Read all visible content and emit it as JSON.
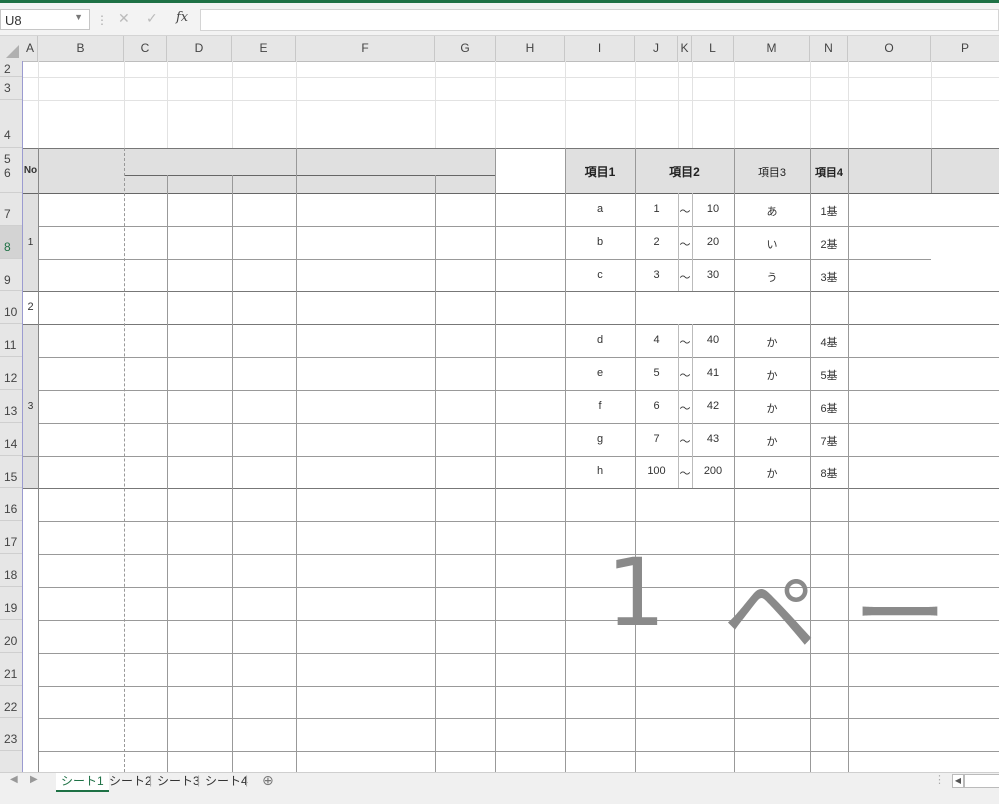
{
  "formula_bar": {
    "name_box": "U8",
    "fx_label": "fx",
    "formula": ""
  },
  "columns": [
    "A",
    "B",
    "C",
    "D",
    "E",
    "F",
    "G",
    "H",
    "I",
    "J",
    "K",
    "L",
    "M",
    "N",
    "O",
    "P"
  ],
  "rows": [
    "2",
    "3",
    "4",
    "5",
    "6",
    "7",
    "8",
    "9",
    "10",
    "11",
    "12",
    "13",
    "14",
    "15",
    "16",
    "17",
    "18",
    "19",
    "20",
    "21",
    "22",
    "23"
  ],
  "table_left": {
    "no_header": "No",
    "numbers": [
      "1",
      "2",
      "3"
    ]
  },
  "table_right": {
    "headers": [
      "項目1",
      "項目2",
      "項目3",
      "項目4"
    ],
    "rows": [
      {
        "item1": "a",
        "from": "1",
        "sep": "〜",
        "to": "10",
        "item3": "あ",
        "item4": "1基"
      },
      {
        "item1": "b",
        "from": "2",
        "sep": "〜",
        "to": "20",
        "item3": "い",
        "item4": "2基"
      },
      {
        "item1": "c",
        "from": "3",
        "sep": "〜",
        "to": "30",
        "item3": "う",
        "item4": "3基"
      },
      {
        "item1": "",
        "from": "",
        "sep": "",
        "to": "",
        "item3": "",
        "item4": ""
      },
      {
        "item1": "d",
        "from": "4",
        "sep": "〜",
        "to": "40",
        "item3": "か",
        "item4": "4基"
      },
      {
        "item1": "e",
        "from": "5",
        "sep": "〜",
        "to": "41",
        "item3": "か",
        "item4": "5基"
      },
      {
        "item1": "f",
        "from": "6",
        "sep": "〜",
        "to": "42",
        "item3": "か",
        "item4": "6基"
      },
      {
        "item1": "g",
        "from": "7",
        "sep": "〜",
        "to": "43",
        "item3": "か",
        "item4": "7基"
      },
      {
        "item1": "h",
        "from": "100",
        "sep": "〜",
        "to": "200",
        "item3": "か",
        "item4": "8基"
      }
    ]
  },
  "watermark": {
    "page": "1",
    "chars": [
      "ペ",
      "ー"
    ]
  },
  "sheet_tabs": [
    "シート1",
    "シート2",
    "シート3",
    "シート4"
  ],
  "active_sheet": 0,
  "colors": {
    "accent": "#1e7145",
    "header_fill": "#e0e0e0",
    "watermark": "#8a8a8a"
  }
}
